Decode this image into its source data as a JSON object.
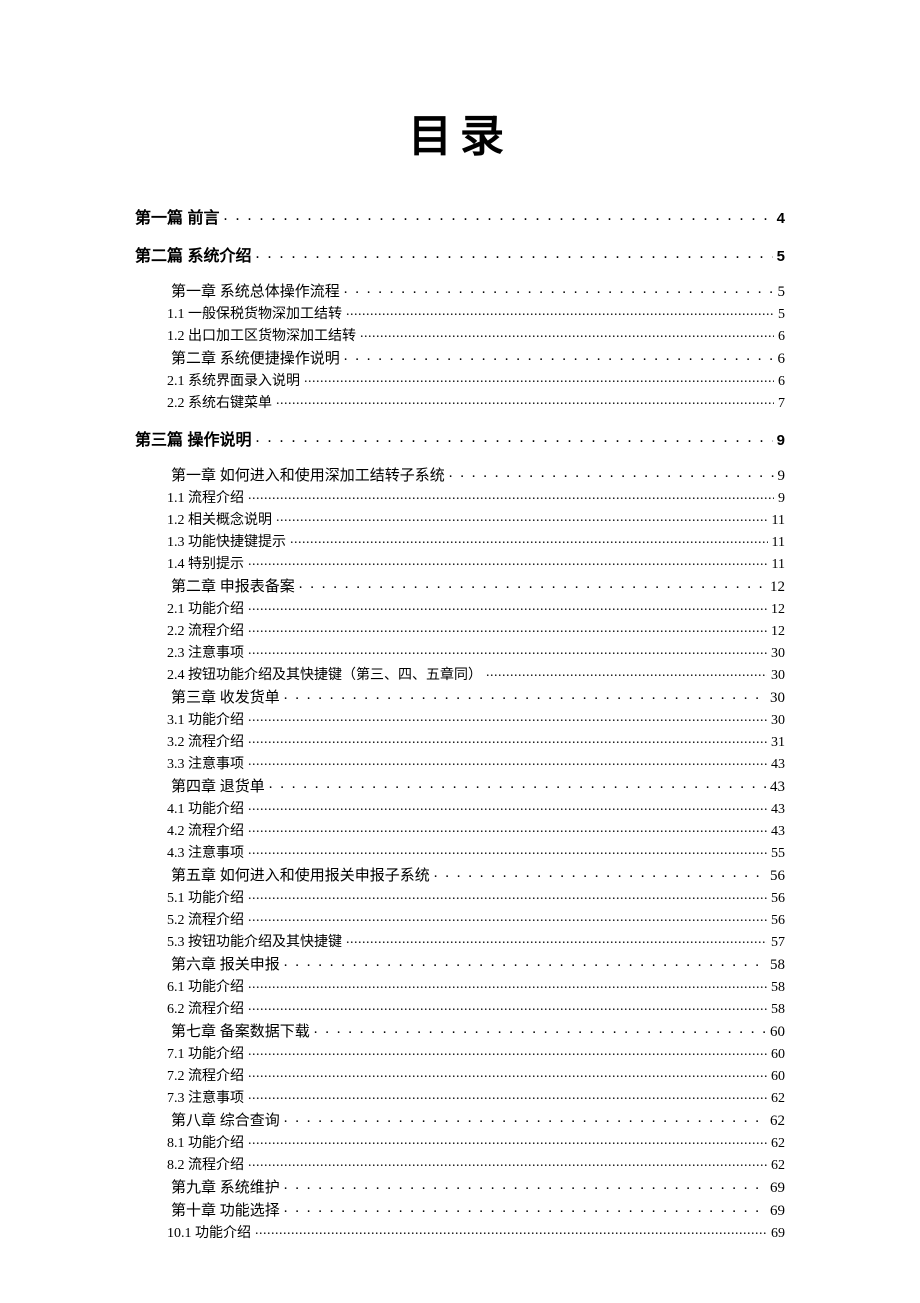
{
  "title": "目录",
  "entries": [
    {
      "level": 1,
      "bold": true,
      "indent": 0,
      "label": "第一篇 前言",
      "page": "4"
    },
    {
      "level": 1,
      "bold": true,
      "indent": 0,
      "label": "第二篇 系统介绍",
      "page": "5"
    },
    {
      "level": 2,
      "bold": false,
      "indent": 1,
      "label": "第一章 系统总体操作流程",
      "page": "5"
    },
    {
      "level": 3,
      "bold": false,
      "indent": 2,
      "label": "1.1 一般保税货物深加工结转",
      "page": "5"
    },
    {
      "level": 3,
      "bold": false,
      "indent": 2,
      "label": "1.2 出口加工区货物深加工结转",
      "page": "6"
    },
    {
      "level": 2,
      "bold": false,
      "indent": 1,
      "label": "第二章 系统便捷操作说明",
      "page": "6"
    },
    {
      "level": 3,
      "bold": false,
      "indent": 2,
      "label": "2.1 系统界面录入说明",
      "page": "6"
    },
    {
      "level": 3,
      "bold": false,
      "indent": 2,
      "label": "2.2 系统右键菜单",
      "page": "7"
    },
    {
      "level": 1,
      "bold": true,
      "indent": 0,
      "label": "第三篇 操作说明",
      "page": "9"
    },
    {
      "level": 2,
      "bold": false,
      "indent": 1,
      "label": "第一章 如何进入和使用深加工结转子系统",
      "page": "9"
    },
    {
      "level": 3,
      "bold": false,
      "indent": 2,
      "label": "1.1 流程介绍",
      "page": "9"
    },
    {
      "level": 3,
      "bold": false,
      "indent": 2,
      "label": "1.2 相关概念说明",
      "page": "11"
    },
    {
      "level": 3,
      "bold": false,
      "indent": 2,
      "label": "1.3 功能快捷键提示",
      "page": "11"
    },
    {
      "level": 3,
      "bold": false,
      "indent": 2,
      "label": "1.4 特别提示",
      "page": "11"
    },
    {
      "level": 2,
      "bold": false,
      "indent": 1,
      "label": "第二章 申报表备案",
      "page": "12"
    },
    {
      "level": 3,
      "bold": false,
      "indent": 2,
      "label": "2.1 功能介绍",
      "page": "12"
    },
    {
      "level": 3,
      "bold": false,
      "indent": 2,
      "label": "2.2 流程介绍",
      "page": "12"
    },
    {
      "level": 3,
      "bold": false,
      "indent": 2,
      "label": "2.3 注意事项",
      "page": "30"
    },
    {
      "level": 3,
      "bold": false,
      "indent": 2,
      "label": "2.4 按钮功能介绍及其快捷键（第三、四、五章同）",
      "page": "30"
    },
    {
      "level": 2,
      "bold": false,
      "indent": 1,
      "label": "第三章 收发货单",
      "page": "30"
    },
    {
      "level": 3,
      "bold": false,
      "indent": 2,
      "label": "3.1 功能介绍",
      "page": "30"
    },
    {
      "level": 3,
      "bold": false,
      "indent": 2,
      "label": "3.2 流程介绍",
      "page": "31"
    },
    {
      "level": 3,
      "bold": false,
      "indent": 2,
      "label": "3.3 注意事项",
      "page": "43"
    },
    {
      "level": 2,
      "bold": false,
      "indent": 1,
      "label": "第四章 退货单",
      "page": "43"
    },
    {
      "level": 3,
      "bold": false,
      "indent": 2,
      "label": "4.1 功能介绍",
      "page": "43"
    },
    {
      "level": 3,
      "bold": false,
      "indent": 2,
      "label": "4.2 流程介绍",
      "page": "43"
    },
    {
      "level": 3,
      "bold": false,
      "indent": 2,
      "label": "4.3 注意事项",
      "page": "55"
    },
    {
      "level": 2,
      "bold": false,
      "indent": 1,
      "label": "第五章 如何进入和使用报关申报子系统",
      "page": "56"
    },
    {
      "level": 3,
      "bold": false,
      "indent": 2,
      "label": "5.1 功能介绍",
      "page": "56"
    },
    {
      "level": 3,
      "bold": false,
      "indent": 2,
      "label": "5.2 流程介绍",
      "page": "56"
    },
    {
      "level": 3,
      "bold": false,
      "indent": 2,
      "label": "5.3 按钮功能介绍及其快捷键",
      "page": "57"
    },
    {
      "level": 2,
      "bold": false,
      "indent": 1,
      "label": "第六章 报关申报",
      "page": "58"
    },
    {
      "level": 3,
      "bold": false,
      "indent": 2,
      "label": "6.1 功能介绍",
      "page": "58"
    },
    {
      "level": 3,
      "bold": false,
      "indent": 2,
      "label": "6.2 流程介绍",
      "page": "58"
    },
    {
      "level": 2,
      "bold": false,
      "indent": 1,
      "label": "第七章 备案数据下载",
      "page": "60"
    },
    {
      "level": 3,
      "bold": false,
      "indent": 2,
      "label": "7.1 功能介绍",
      "page": "60"
    },
    {
      "level": 3,
      "bold": false,
      "indent": 2,
      "label": "7.2 流程介绍",
      "page": "60"
    },
    {
      "level": 3,
      "bold": false,
      "indent": 2,
      "label": "7.3 注意事项",
      "page": "62"
    },
    {
      "level": 2,
      "bold": false,
      "indent": 1,
      "label": "第八章 综合查询",
      "page": "62"
    },
    {
      "level": 3,
      "bold": false,
      "indent": 2,
      "label": "8.1 功能介绍",
      "page": "62"
    },
    {
      "level": 3,
      "bold": false,
      "indent": 2,
      "label": "8.2 流程介绍",
      "page": "62"
    },
    {
      "level": 2,
      "bold": false,
      "indent": 1,
      "label": "第九章 系统维护",
      "page": "69"
    },
    {
      "level": 2,
      "bold": false,
      "indent": 1,
      "label": "第十章 功能选择",
      "page": "69"
    },
    {
      "level": 3,
      "bold": false,
      "indent": 2,
      "label": "10.1 功能介绍",
      "page": "69"
    }
  ]
}
